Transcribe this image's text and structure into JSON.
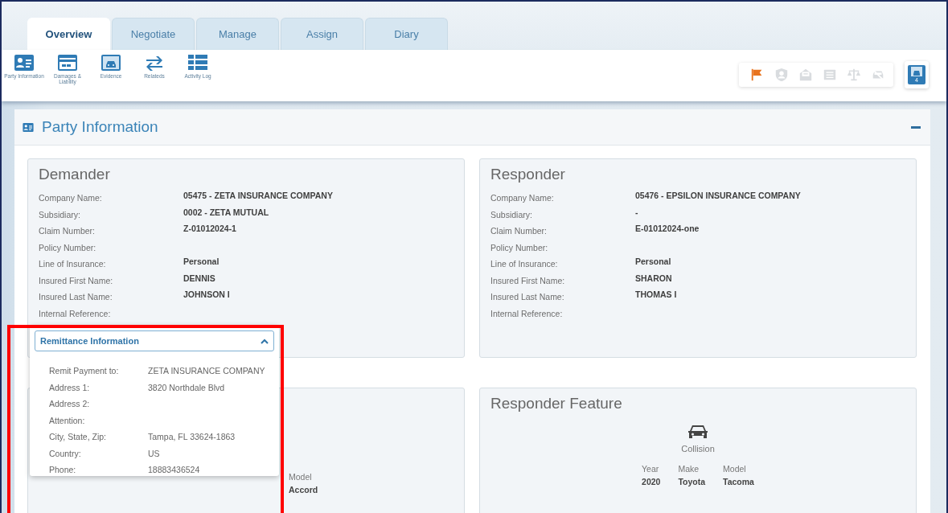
{
  "tabs": [
    {
      "label": "Overview",
      "selected": true
    },
    {
      "label": "Negotiate",
      "selected": false
    },
    {
      "label": "Manage",
      "selected": false
    },
    {
      "label": "Assign",
      "selected": false
    },
    {
      "label": "Diary",
      "selected": false
    }
  ],
  "toolbar": [
    {
      "label": "Party Information",
      "kind": "id-card"
    },
    {
      "label": "Damages & Liability",
      "kind": "card"
    },
    {
      "label": "Evidence",
      "kind": "photo"
    },
    {
      "label": "Relateds",
      "kind": "arrows"
    },
    {
      "label": "Activity Log",
      "kind": "list"
    }
  ],
  "status_icons": [
    {
      "kind": "flag",
      "active": true
    },
    {
      "kind": "person-shield",
      "active": false
    },
    {
      "kind": "envelope",
      "active": false
    },
    {
      "kind": "list",
      "active": false
    },
    {
      "kind": "scale",
      "active": false
    },
    {
      "kind": "car-off",
      "active": false
    }
  ],
  "evidence_count": "4",
  "section": {
    "title": "Party Information",
    "expanded": true
  },
  "demander": {
    "title": "Demander",
    "fields": [
      {
        "label": "Company Name:",
        "value": "05475 - ZETA INSURANCE COMPANY"
      },
      {
        "label": "Subsidiary:",
        "value": "0002 - ZETA MUTUAL"
      },
      {
        "label": "Claim Number:",
        "value": "Z-01012024-1"
      },
      {
        "label": "Policy Number:"
      },
      {
        "label": "Line of Insurance:",
        "value": "Personal"
      },
      {
        "label": "Insured First Name:",
        "value": "DENNIS"
      },
      {
        "label": "Insured Last Name:",
        "value": "JOHNSON I"
      },
      {
        "label": "Internal Reference:"
      }
    ]
  },
  "responder": {
    "title": "Responder",
    "fields": [
      {
        "label": "Company Name:",
        "value": "05476 - EPSILON INSURANCE COMPANY"
      },
      {
        "label": "Subsidiary:",
        "value": "-"
      },
      {
        "label": "Claim Number:",
        "value": "E-01012024-one"
      },
      {
        "label": "Policy Number:"
      },
      {
        "label": "Line of Insurance:",
        "value": "Personal"
      },
      {
        "label": "Insured First Name:",
        "value": "SHARON"
      },
      {
        "label": "Insured Last Name:",
        "value": "THOMAS I"
      },
      {
        "label": "Internal Reference:"
      }
    ]
  },
  "remittance": {
    "title": "Remittance Information",
    "expanded": true,
    "fields": [
      {
        "label": "Remit Payment to:",
        "value": "ZETA INSURANCE COMPANY"
      },
      {
        "label": "Address 1:",
        "value": "3820 Northdale Blvd"
      },
      {
        "label": "Address 2:"
      },
      {
        "label": "Attention:"
      },
      {
        "label": "City, State, Zip:",
        "value": "Tampa, FL 33624-1863"
      },
      {
        "label": "Country:",
        "value": "US"
      },
      {
        "label": "Phone:",
        "value": "18883436524"
      }
    ]
  },
  "demander_feature": {
    "columns": [
      {
        "label": "Model",
        "value": "Accord"
      }
    ]
  },
  "responder_feature": {
    "title": "Responder Feature",
    "loss_type": "Collision",
    "columns": [
      {
        "label": "Year",
        "value": "2020"
      },
      {
        "label": "Make",
        "value": "Toyota"
      },
      {
        "label": "Model",
        "value": "Tacoma"
      }
    ]
  }
}
